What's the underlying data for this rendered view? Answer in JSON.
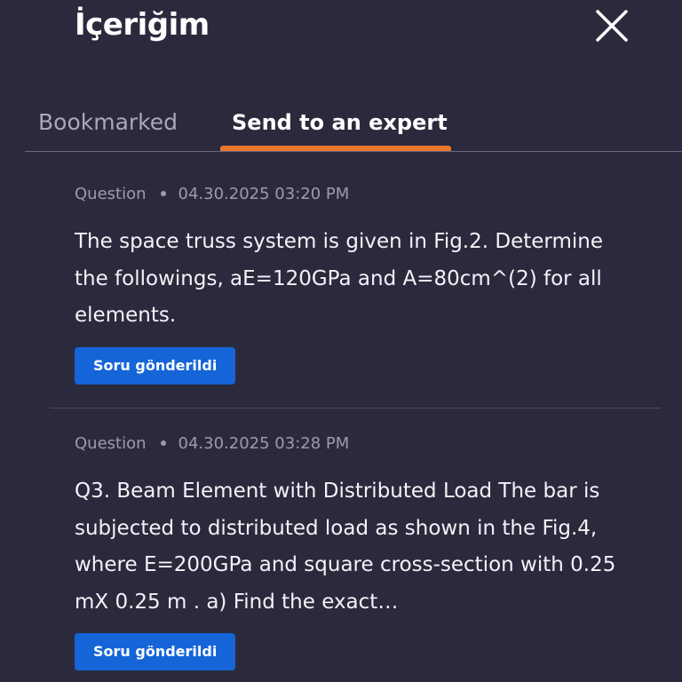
{
  "header": {
    "title": "İçeriğim",
    "close_icon": "close-icon"
  },
  "tabs": [
    {
      "label": "Bookmarked",
      "active": false
    },
    {
      "label": "Send to an expert",
      "active": true
    }
  ],
  "colors": {
    "background": "#2b2a3d",
    "active_tab_indicator": "#e9762b",
    "badge": "#1565d8"
  },
  "questions": [
    {
      "type": "Question",
      "timestamp": "04.30.2025 03:20 PM",
      "text": "The space truss system is given in Fig.2. Determine the followings, aE=120GPa and A=80cm^(2) for all elements.",
      "status": "Soru gönderildi"
    },
    {
      "type": "Question",
      "timestamp": "04.30.2025 03:28 PM",
      "text": "Q3. Beam Element with Distributed Load The bar is subjected to distributed load as shown in the Fig.4, where E=200GPa and square cross-section with 0.25 mX 0.25 m . a) Find the exact…",
      "status": "Soru gönderildi"
    }
  ]
}
